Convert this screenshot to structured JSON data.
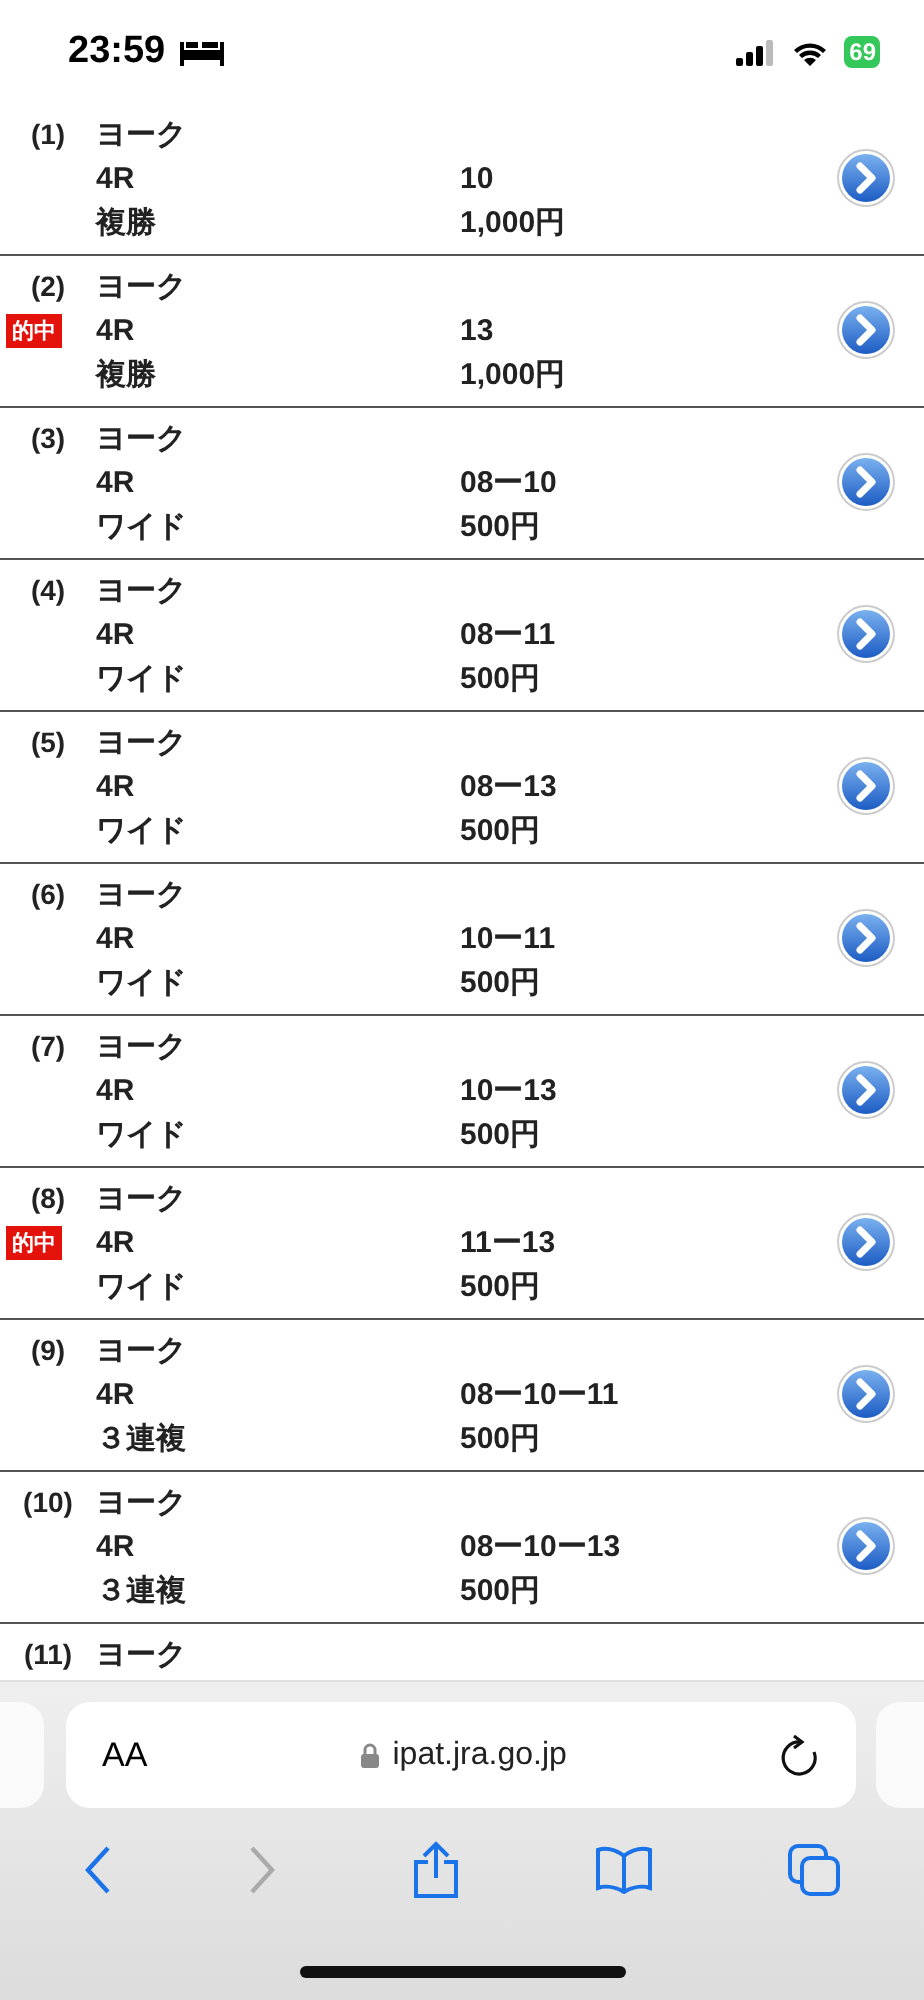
{
  "status_bar": {
    "time": "23:59",
    "battery": "69"
  },
  "bets": [
    {
      "number": "(1)",
      "venue": "ヨーク",
      "race": "4R",
      "bet_type": "複勝",
      "selection": "10",
      "amount": "1,000円"
    },
    {
      "number": "(2)",
      "badge": "的中",
      "venue": "ヨーク",
      "race": "4R",
      "bet_type": "複勝",
      "selection": "13",
      "amount": "1,000円"
    },
    {
      "number": "(3)",
      "venue": "ヨーク",
      "race": "4R",
      "bet_type": "ワイド",
      "selection": "08ー10",
      "amount": "500円"
    },
    {
      "number": "(4)",
      "venue": "ヨーク",
      "race": "4R",
      "bet_type": "ワイド",
      "selection": "08ー11",
      "amount": "500円"
    },
    {
      "number": "(5)",
      "venue": "ヨーク",
      "race": "4R",
      "bet_type": "ワイド",
      "selection": "08ー13",
      "amount": "500円"
    },
    {
      "number": "(6)",
      "venue": "ヨーク",
      "race": "4R",
      "bet_type": "ワイド",
      "selection": "10ー11",
      "amount": "500円"
    },
    {
      "number": "(7)",
      "venue": "ヨーク",
      "race": "4R",
      "bet_type": "ワイド",
      "selection": "10ー13",
      "amount": "500円"
    },
    {
      "number": "(8)",
      "badge": "的中",
      "venue": "ヨーク",
      "race": "4R",
      "bet_type": "ワイド",
      "selection": "11ー13",
      "amount": "500円"
    },
    {
      "number": "(9)",
      "venue": "ヨーク",
      "race": "4R",
      "bet_type": "３連複",
      "selection": "08ー10ー11",
      "amount": "500円"
    },
    {
      "number": "(10)",
      "venue": "ヨーク",
      "race": "4R",
      "bet_type": "３連複",
      "selection": "08ー10ー13",
      "amount": "500円"
    },
    {
      "number": "(11)",
      "venue": "ヨーク"
    }
  ],
  "browser": {
    "text_size": "AA",
    "url": "ipat.jra.go.jp"
  }
}
